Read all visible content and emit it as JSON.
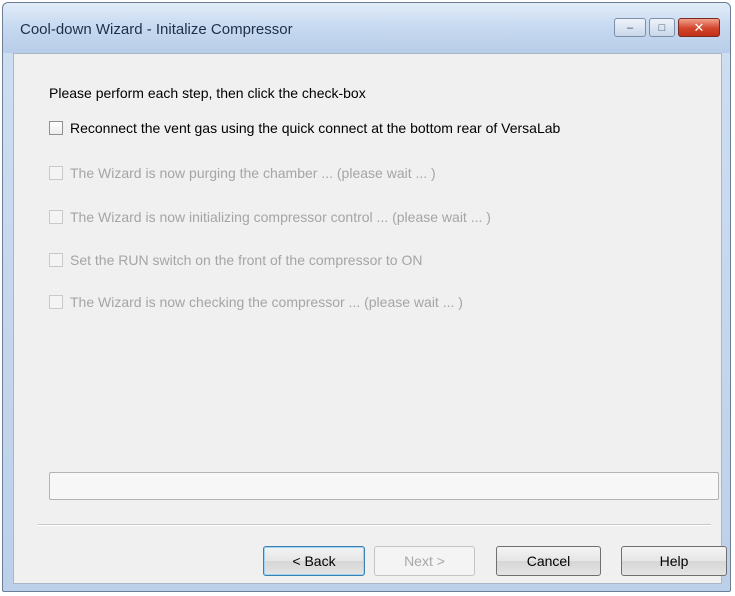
{
  "window": {
    "title": "Cool-down Wizard - Initalize Compressor",
    "controls": {
      "minimize": "–",
      "maximize": "□",
      "close": "✕"
    }
  },
  "instruction": "Please perform each step, then click the check-box",
  "steps": [
    {
      "label": "Reconnect the vent gas using the quick connect at the bottom rear of VersaLab",
      "checked": false,
      "enabled": true
    },
    {
      "label": "The Wizard is now purging the chamber ... (please wait ... )",
      "checked": false,
      "enabled": false
    },
    {
      "label": "The Wizard is now initializing compressor control ... (please wait ... )",
      "checked": false,
      "enabled": false
    },
    {
      "label": "Set the RUN switch on the front of the compressor to ON",
      "checked": false,
      "enabled": false
    },
    {
      "label": "The Wizard is now checking the compressor ... (please wait ... )",
      "checked": false,
      "enabled": false
    }
  ],
  "progress": {
    "value": 0
  },
  "buttons": {
    "back": "< Back",
    "next": "Next >",
    "cancel": "Cancel",
    "help": "Help"
  },
  "colors": {
    "titlebar": "#c8daf0",
    "close_button": "#d2452c",
    "client_background": "#f0f0f0",
    "disabled_text": "#a5a5a5"
  }
}
